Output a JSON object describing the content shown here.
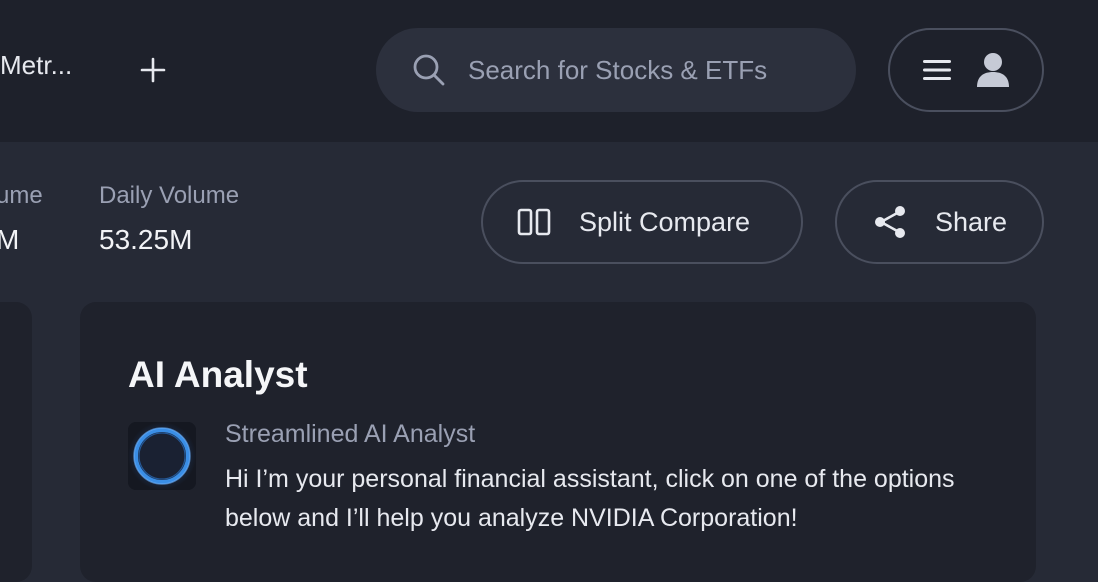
{
  "topbar": {
    "tab_label": "Metr...",
    "add_tab_icon": "plus-icon",
    "search": {
      "placeholder": "Search for Stocks & ETFs",
      "icon": "search-icon"
    },
    "menu_icon": "hamburger-menu-icon",
    "user_icon": "user-icon"
  },
  "stats": [
    {
      "label": "ume",
      "value": "M"
    },
    {
      "label": "Daily Volume",
      "value": "53.25M"
    }
  ],
  "actions": {
    "split_compare_label": "Split Compare",
    "split_compare_icon": "split-columns-icon",
    "share_label": "Share",
    "share_icon": "share-icon"
  },
  "ai_analyst": {
    "title": "AI Analyst",
    "assistant_name": "Streamlined AI Analyst",
    "message": "Hi I’m your personal financial assistant, click on one of the options below and I’ll help you analyze NVIDIA Corporation!",
    "avatar_icon": "ai-orb-icon"
  },
  "colors": {
    "topbar_bg": "#1e212b",
    "page_bg": "#262a36",
    "card_bg": "#1f222c",
    "accent_blue": "#3a8ee6",
    "muted_text": "#9aa0b3"
  }
}
